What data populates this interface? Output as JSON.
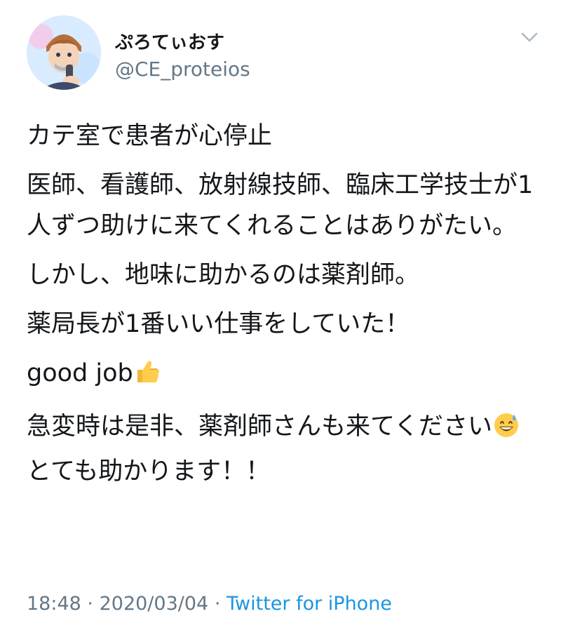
{
  "header": {
    "display_name": "ぷろてぃおす",
    "handle": "@CE_proteios"
  },
  "tweet": {
    "paragraphs": [
      {
        "text": "カテ室で患者が心停止"
      },
      {
        "text": "医師、看護師、放射線技師、臨床工学技士が1人ずつ助けに来てくれることはありがたい。"
      },
      {
        "text": "しかし、地味に助かるのは薬剤師。"
      },
      {
        "text": "薬局長が1番いい仕事をしていた！"
      },
      {
        "text": "good job",
        "emoji": "thumbs-up-icon"
      },
      {
        "text": "急変時は是非、薬剤師さんも来てください",
        "emoji": "grinning-sweat-icon",
        "after": "とても助かります！！"
      }
    ]
  },
  "meta": {
    "time": "18:48",
    "separator": "·",
    "date": "2020/03/04",
    "source": "Twitter for iPhone"
  },
  "colors": {
    "text": "#14171a",
    "secondary": "#657786",
    "link": "#1b95e0"
  }
}
